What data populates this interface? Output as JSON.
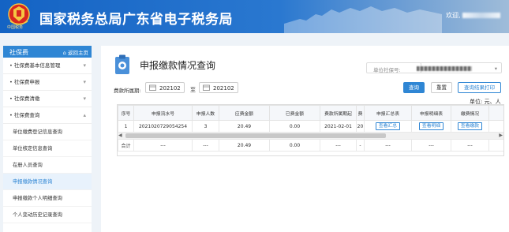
{
  "header": {
    "site_title": "国家税务总局广东省电子税务局",
    "emblem_text": "中国税务",
    "welcome": "欢迎,"
  },
  "sidebar": {
    "head_title": "社保费",
    "home_link": "返回主页",
    "groups": [
      {
        "label": "社保费基本信息管理",
        "arrow": "▾"
      },
      {
        "label": "社保费申报",
        "arrow": "▾"
      },
      {
        "label": "社保费清缴",
        "arrow": "▾"
      },
      {
        "label": "社保费查询",
        "arrow": "▴"
      }
    ],
    "sub_items": [
      {
        "label": "单位缴费登记信息查询",
        "active": false
      },
      {
        "label": "单位核定信息查询",
        "active": false
      },
      {
        "label": "在册人员查询",
        "active": false
      },
      {
        "label": "申报缴款情况查询",
        "active": true
      },
      {
        "label": "申报缴款个人明细查询",
        "active": false
      },
      {
        "label": "个人变动历史记录查询",
        "active": false
      }
    ]
  },
  "main": {
    "title": "申报缴款情况查询",
    "unit_id_label": "单位社保号:",
    "fee_period_label": "费款所属期:",
    "date_from": "202102",
    "to_label": "至",
    "date_to": "202102",
    "buttons": {
      "query": "查询",
      "reset": "重置",
      "print": "查询结果打印"
    },
    "unit_note": "单位: 元、人"
  },
  "table": {
    "headers": [
      "序号",
      "申报流水号",
      "申报人数",
      "应费金额",
      "已费金额",
      "费款所属期起",
      "费",
      "申报汇总表",
      "申报明细表",
      "缴费情况"
    ],
    "rows": [
      {
        "seq": "1",
        "serial": "2021020729054254",
        "count": "3",
        "payable": "20.49",
        "paid": "0.00",
        "period_start": "2021-02-01",
        "trunc": "20",
        "summary_btn": "查看汇总",
        "detail_btn": "查看明细",
        "payment_btn": "查看缴款"
      }
    ],
    "total": {
      "label": "合计",
      "serial": "---",
      "count": "---",
      "payable": "20.49",
      "paid": "0.00",
      "period_start": "---",
      "trunc": "-",
      "summary": "---",
      "detail": "---",
      "payment": "---"
    }
  },
  "colors": {
    "accent": "#2f86d4",
    "header_blue": "#1463c4",
    "active_bg": "#e8f2fc"
  }
}
